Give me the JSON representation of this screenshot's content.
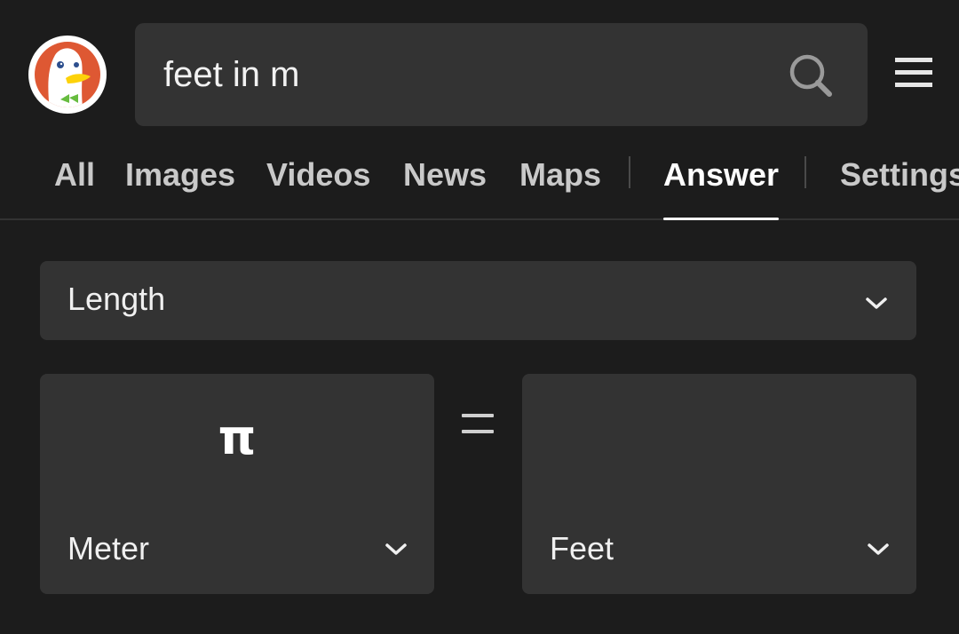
{
  "search": {
    "query": "feet in m"
  },
  "tabs": [
    {
      "label": "All"
    },
    {
      "label": "Images"
    },
    {
      "label": "Videos"
    },
    {
      "label": "News"
    },
    {
      "label": "Maps"
    },
    {
      "label": "Answer",
      "active": true
    },
    {
      "label": "Settings"
    }
  ],
  "converter": {
    "category": "Length",
    "from_value": "π",
    "from_unit": "Meter",
    "to_value": "",
    "to_unit": "Feet"
  },
  "colors": {
    "background": "#1c1c1c",
    "surface": "#333333",
    "text": "#ececec",
    "tab_inactive": "#c9c9c9",
    "logo_orange": "#de5833",
    "logo_beak": "#fdd20a",
    "logo_bowtie": "#67bc3f"
  },
  "icons": {
    "logo": "duckduckgo-logo",
    "search": "search-icon",
    "menu": "hamburger-menu-icon",
    "dropdown": "chevron-down-icon"
  }
}
